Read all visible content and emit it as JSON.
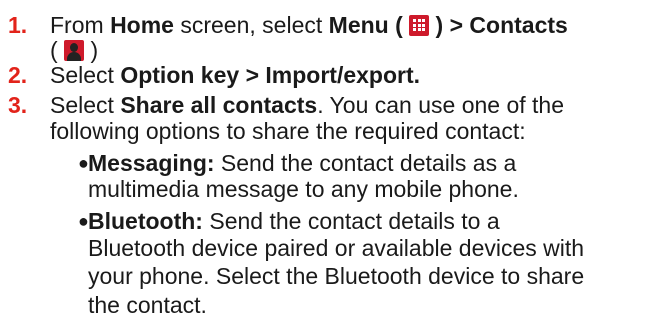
{
  "steps": [
    {
      "number": "1.",
      "line1": {
        "t1": "From ",
        "b1": "Home",
        "t2": " screen, select ",
        "b2": "Menu",
        "t3": " ( ",
        "t4": " ) > Contacts"
      },
      "line2": {
        "t1": "( ",
        "t2": " )"
      }
    },
    {
      "number": "2.",
      "line1": {
        "t1": "Select ",
        "b1": "Option key > Import/export."
      }
    },
    {
      "number": "3.",
      "line1": {
        "t1": "Select ",
        "b1": "Share all contacts",
        "t2": ". You can use one of the"
      },
      "line2": "following options to share the required contact:"
    }
  ],
  "bullets": [
    {
      "label": "Messaging:",
      "lines": [
        " Send the contact details as a",
        "multimedia message to any mobile phone."
      ]
    },
    {
      "label": "Bluetooth:",
      "lines": [
        " Send the contact details to a",
        "Bluetooth device paired or available devices with",
        "your phone. Select  the Bluetooth device to share",
        "the contact."
      ]
    }
  ],
  "icons": {
    "menu": "menu-grid-icon",
    "contacts": "contacts-person-icon",
    "accent_color": "#e2231a"
  }
}
